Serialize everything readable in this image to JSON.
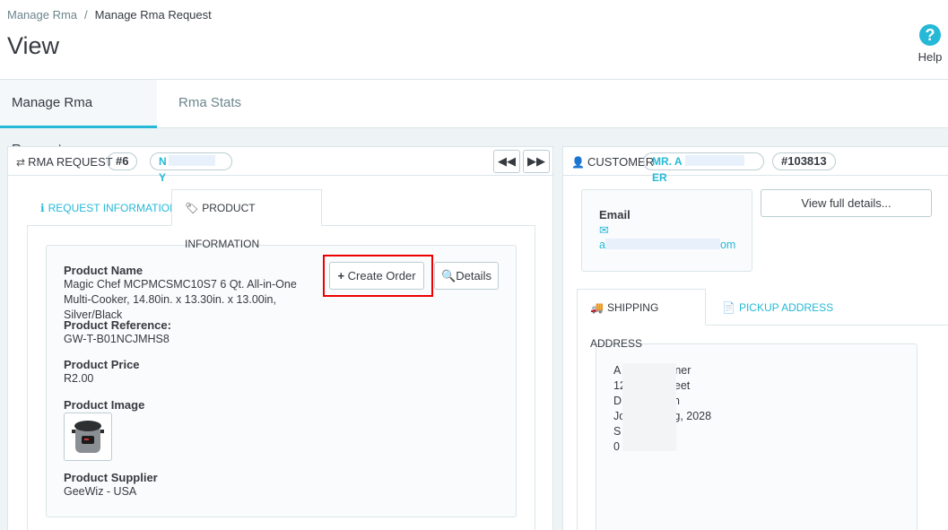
{
  "breadcrumb": {
    "parent": "Manage Rma",
    "separator": "/",
    "current": "Manage Rma Request"
  },
  "page_title": "View",
  "help": {
    "label": "Help",
    "icon": "question-circle-icon"
  },
  "tabs": [
    {
      "label": "Manage Rma Request",
      "active": true
    },
    {
      "label": "Rma Stats",
      "active": false
    }
  ],
  "rma_panel": {
    "title": "RMA REQUEST",
    "number": "#6",
    "customer_tag_start": "N",
    "customer_tag_end": "Y",
    "prev_icon": "backward-icon",
    "next_icon": "forward-icon",
    "subtabs": [
      {
        "label": "REQUEST INFORMATION",
        "icon": "info-icon",
        "active": false
      },
      {
        "label": "PRODUCT INFORMATION",
        "icon": "tag-icon",
        "active": true
      }
    ],
    "product": {
      "name_label": "Product Name",
      "name_value": "Magic Chef MCPMCSMC10S7 6 Qt. All-in-One Multi-Cooker, 14.80in. x 13.30in. x 13.00in, Silver/Black",
      "reference_label": "Product Reference:",
      "reference_value": "GW-T-B01NCJMHS8",
      "price_label": "Product Price",
      "price_value": "R2.00",
      "image_label": "Product Image",
      "supplier_label": "Product Supplier",
      "supplier_value": "GeeWiz - USA"
    },
    "create_order_label": "Create Order",
    "details_label": "Details"
  },
  "customer_panel": {
    "title": "CUSTOMER",
    "name_start": "MR. A",
    "name_end": "ER",
    "id": "#103813",
    "email_label": "Email",
    "email_start": "a",
    "email_end": "om",
    "view_full_details": "View full details...",
    "address_tabs": [
      {
        "label": "SHIPPING ADDRESS",
        "icon": "truck-icon",
        "active": true
      },
      {
        "label": "PICKUP ADDRESS",
        "icon": "file-icon",
        "active": false
      }
    ],
    "address_lines": [
      {
        "start": "A",
        "end": "ner"
      },
      {
        "start": "12",
        "end": "eet"
      },
      {
        "start": "D",
        "end": "n"
      },
      {
        "start": "Jo",
        "end": "rg, 2028"
      },
      {
        "start": "S",
        "end": ""
      },
      {
        "start": "0",
        "end": ""
      }
    ]
  },
  "colors": {
    "accent": "#25b9d7",
    "highlight": "#e00000",
    "border": "#dbe6e9"
  }
}
